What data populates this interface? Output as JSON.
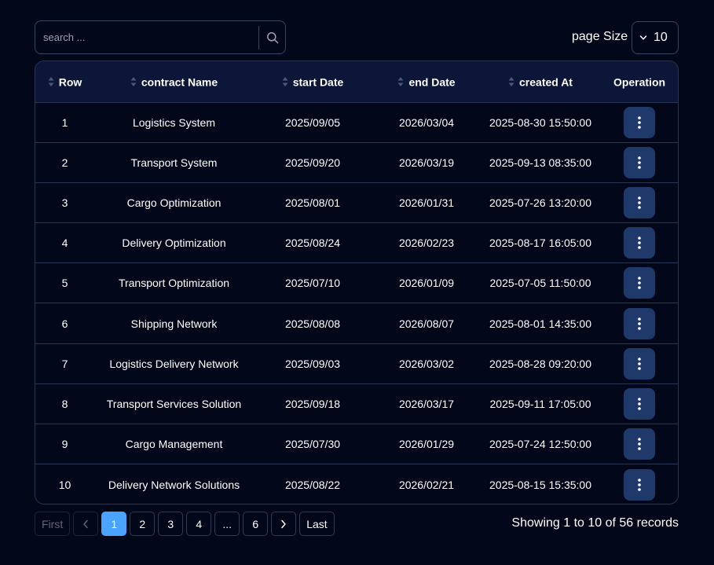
{
  "search": {
    "placeholder": "search ..."
  },
  "page_size": {
    "label": "page Size",
    "value": "10"
  },
  "table": {
    "headers": {
      "row": "Row",
      "contract_name": "contract Name",
      "start_date": "start Date",
      "end_date": "end Date",
      "created_at": "created At",
      "operation": "Operation"
    },
    "rows": [
      {
        "row": "1",
        "contract_name": "Logistics System",
        "start_date": "2025/09/05",
        "end_date": "2026/03/04",
        "created_at": "2025-08-30 15:50:00"
      },
      {
        "row": "2",
        "contract_name": "Transport System",
        "start_date": "2025/09/20",
        "end_date": "2026/03/19",
        "created_at": "2025-09-13 08:35:00"
      },
      {
        "row": "3",
        "contract_name": "Cargo Optimization",
        "start_date": "2025/08/01",
        "end_date": "2026/01/31",
        "created_at": "2025-07-26 13:20:00"
      },
      {
        "row": "4",
        "contract_name": "Delivery Optimization",
        "start_date": "2025/08/24",
        "end_date": "2026/02/23",
        "created_at": "2025-08-17 16:05:00"
      },
      {
        "row": "5",
        "contract_name": "Transport Optimization",
        "start_date": "2025/07/10",
        "end_date": "2026/01/09",
        "created_at": "2025-07-05 11:50:00"
      },
      {
        "row": "6",
        "contract_name": "Shipping Network",
        "start_date": "2025/08/08",
        "end_date": "2026/08/07",
        "created_at": "2025-08-01 14:35:00"
      },
      {
        "row": "7",
        "contract_name": "Logistics Delivery Network",
        "start_date": "2025/09/03",
        "end_date": "2026/03/02",
        "created_at": "2025-08-28 09:20:00"
      },
      {
        "row": "8",
        "contract_name": "Transport Services Solution",
        "start_date": "2025/09/18",
        "end_date": "2026/03/17",
        "created_at": "2025-09-11 17:05:00"
      },
      {
        "row": "9",
        "contract_name": "Cargo Management",
        "start_date": "2025/07/30",
        "end_date": "2026/01/29",
        "created_at": "2025-07-24 12:50:00"
      },
      {
        "row": "10",
        "contract_name": "Delivery Network Solutions",
        "start_date": "2025/08/22",
        "end_date": "2026/02/21",
        "created_at": "2025-08-15 15:35:00"
      }
    ]
  },
  "pagination": {
    "first": "First",
    "last": "Last",
    "pages": [
      "1",
      "2",
      "3",
      "4",
      "...",
      "6"
    ],
    "current": "1",
    "summary": "Showing 1 to 10 of 56 records"
  },
  "colors": {
    "background": "#020819",
    "header_bg": "#0b1638",
    "border": "#2a3550",
    "action_button": "#1f3a6a",
    "active_page": "#4aa3ff"
  },
  "icons": {
    "search": "search-icon",
    "select": "chevron-down-icon",
    "sort": "sort-icon",
    "row_action": "more-vertical-icon",
    "prev": "chevron-left-icon",
    "next": "chevron-right-icon"
  }
}
